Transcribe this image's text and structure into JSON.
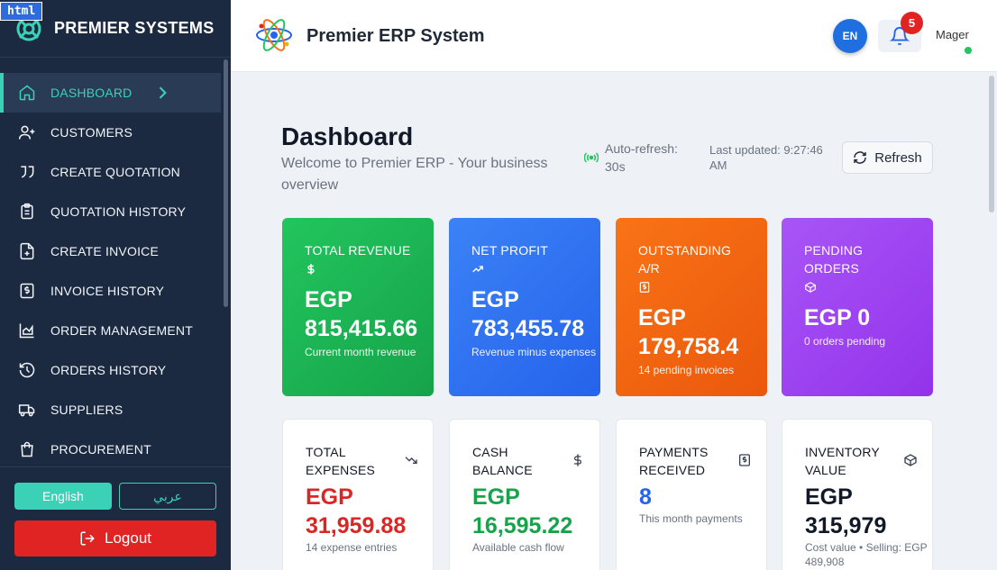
{
  "overlay_badge": "html",
  "brand": {
    "name": "PREMIER SYSTEMS"
  },
  "sidebar": {
    "items": [
      {
        "label": "DASHBOARD",
        "icon": "home-icon",
        "active": true
      },
      {
        "label": "CUSTOMERS",
        "icon": "user-plus-icon"
      },
      {
        "label": "CREATE QUOTATION",
        "icon": "quote-icon"
      },
      {
        "label": "QUOTATION HISTORY",
        "icon": "clipboard-list-icon"
      },
      {
        "label": "CREATE INVOICE",
        "icon": "file-plus-icon"
      },
      {
        "label": "INVOICE HISTORY",
        "icon": "invoice-dollar-icon"
      },
      {
        "label": "ORDER MANAGEMENT",
        "icon": "chart-area-icon"
      },
      {
        "label": "ORDERS HISTORY",
        "icon": "history-icon"
      },
      {
        "label": "SUPPLIERS",
        "icon": "truck-icon"
      },
      {
        "label": "PROCUREMENT",
        "icon": "shopping-bag-icon"
      }
    ],
    "lang_english": "English",
    "lang_arabic": "عربي",
    "logout": "Logout"
  },
  "topbar": {
    "title": "Premier ERP System",
    "lang_code": "EN",
    "notifications": "5",
    "avatar_alt": "Mager"
  },
  "page": {
    "title": "Dashboard",
    "subtitle": "Welcome to Premier ERP - Your business overview",
    "auto_refresh": "Auto-refresh: 30s",
    "last_updated": "Last updated: 9:27:46 AM",
    "refresh_label": "Refresh"
  },
  "kpi_cards": [
    {
      "label": "TOTAL REVENUE",
      "value": "EGP 815,415.66",
      "sub": "Current month revenue",
      "color": "#22c55e",
      "icon": "dollar-icon"
    },
    {
      "label": "NET PROFIT",
      "value": "EGP 783,455.78",
      "sub": "Revenue minus expenses",
      "color": "#3b82f6",
      "icon": "trending-up-icon"
    },
    {
      "label": "OUTSTANDING A/R",
      "value": "EGP 179,758.4",
      "sub": "14 pending invoices",
      "color": "#f97316",
      "icon": "receipt-icon"
    },
    {
      "label": "PENDING ORDERS",
      "value": "EGP 0",
      "sub": "0 orders pending",
      "color": "#a855f7",
      "icon": "box-icon"
    }
  ],
  "stat_cards": [
    {
      "label": "TOTAL EXPENSES",
      "value": "EGP 31,959.88",
      "sub": "14 expense entries",
      "value_color": "#dc2626",
      "icon": "trending-down-icon"
    },
    {
      "label": "CASH BALANCE",
      "value": "EGP 16,595.22",
      "sub": "Available cash flow",
      "value_color": "#16a34a",
      "icon": "dollar-icon"
    },
    {
      "label": "PAYMENTS RECEIVED",
      "value": "8",
      "sub": "This month payments",
      "value_color": "#2563eb",
      "icon": "receipt-icon"
    },
    {
      "label": "INVENTORY VALUE",
      "value": "EGP 315,979",
      "sub": "Cost value • Selling: EGP 489,908",
      "value_color": "#111827",
      "icon": "box-icon"
    }
  ]
}
